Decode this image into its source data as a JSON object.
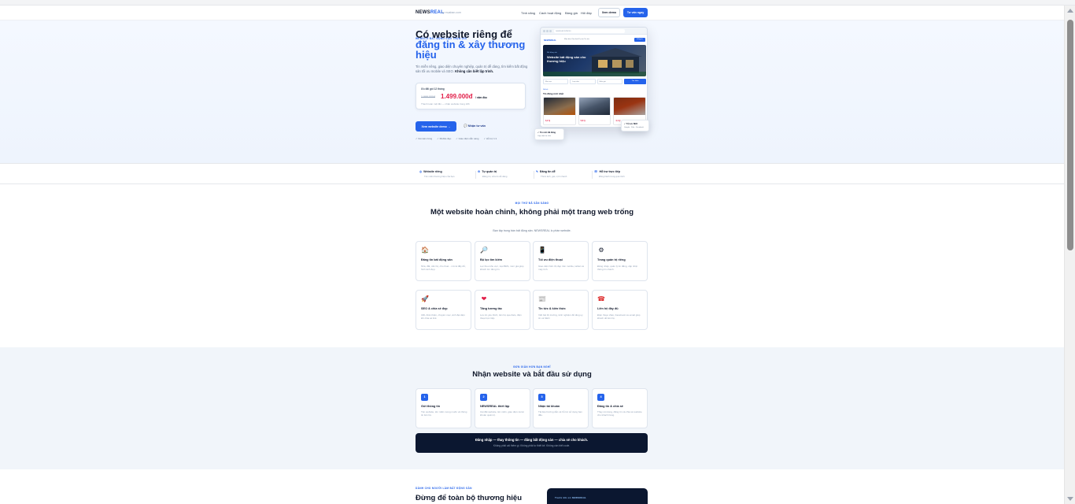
{
  "header": {
    "logo_main": "NEWS",
    "logo_accent": "REAL",
    "logo_sub": "by muaban.com",
    "nav": [
      "Tính năng",
      "Cách hoạt động",
      "Bảng giá",
      "Hỏi đáp"
    ],
    "demo_button": "Xem demo",
    "start_button": "Tư vấn ngay"
  },
  "hero": {
    "eyebrow": "Website bất động sản trọn gói",
    "title_line1": "Có website riêng để",
    "title_accent": "đăng tin & xây thương hiệu",
    "description": "Tin miễn riêng, giao diện chuyên nghiệp, quản trị dễ dàng, tìm kiếm bất động sản tối ưu mobile và SEO.",
    "description_bold": "Không cần biết lập trình.",
    "price_label": "Ưu đãi gói 12 tháng",
    "price_old": "1.999.000đ",
    "price_new": "1.499.000đ",
    "price_unit": "/ năm đầu",
    "price_note": "Thanh toán một lần — nhận website trong 24h",
    "cta_primary": "Xem website demo →",
    "cta_secondary": "Nhận tư vấn",
    "checks": [
      "Domain riêng",
      "Mobile đẹp",
      "Giao diện sẵn sàng",
      "Hỗ trợ 1:1"
    ]
  },
  "mockup": {
    "url": "newsreal.vn/demo",
    "logo": "NEWSREAL",
    "menu": "Mua bán   Cho thuê   Dự án   Tin tức",
    "button": "Đăng tin",
    "hero_tag": "Bất động sản",
    "hero_title": "Website bất động sản cho thương hiệu",
    "fields": [
      "Khu vực",
      "Loại nhà",
      "Mức giá"
    ],
    "search_button": "Tìm kiếm",
    "section_tag": "Nổi bật",
    "section_title": "Tin đăng mới nhất",
    "prices": [
      "3,2 tỷ",
      "5,8 tỷ",
      "4,1 tỷ"
    ],
    "float_a_title": "Tin mới đã đăng",
    "float_a_sub": "Cập nhật tức thời",
    "float_b_title": "Tối ưu SEO",
    "float_b_sub": "Google · Zalo · Facebook"
  },
  "strip": [
    {
      "title": "Website riêng",
      "sub": "Tên miền thương hiệu của bạn",
      "icon": "globe-icon"
    },
    {
      "title": "Tự quản trị",
      "sub": "Đăng tin, sửa tin dễ dàng",
      "icon": "gear-icon"
    },
    {
      "title": "Đăng tin dễ",
      "sub": "Thêm ảnh, giá, vị trí nhanh",
      "icon": "edit-icon"
    },
    {
      "title": "Hỗ trợ trực tiếp",
      "sub": "Đồng hành trong quá trình",
      "icon": "support-icon"
    }
  ],
  "features": {
    "eyebrow": "Mọi thứ đã sẵn sàng",
    "title": "Một website hoàn chỉnh, không phải một trang web trống",
    "subtitle": "Bạn tập trung bán bất động sản. NEWSREAL lo phần website.",
    "cards": [
      {
        "icon": "house-icon",
        "glyph": "🏠",
        "title": "Đăng tin bất động sản",
        "desc": "Nhà, đất, căn hộ, cho thuê... mô tả đầy đủ, hình ảnh đẹp."
      },
      {
        "icon": "search-icon",
        "glyph": "🔎",
        "title": "Bộ lọc tìm kiếm",
        "desc": "Lọc theo khu vực, loại BĐS, mức giá giúp khách tìm đúng tin."
      },
      {
        "icon": "phone-icon",
        "glyph": "📱",
        "title": "Tối ưu điện thoại",
        "desc": "Giao diện hiển thị đẹp trên mobile, tablet và máy tính."
      },
      {
        "icon": "dashboard-icon",
        "glyph": "⚙",
        "title": "Trang quản trị riêng",
        "desc": "Đăng nhập, quản lý tin đăng, cập nhật thông tin nhanh."
      },
      {
        "icon": "seo-icon",
        "glyph": "🚀",
        "title": "SEO & chia sẻ đẹp",
        "desc": "URL thân thiện, chuyên mục, ảnh đại diện khi chia sẻ link."
      },
      {
        "icon": "heart-icon",
        "glyph": "❤",
        "title": "Tăng tương tác",
        "desc": "Lưu tin yêu thích, liên hệ qua Zalo, điện thoại trực tiếp."
      },
      {
        "icon": "news-icon",
        "glyph": "📰",
        "title": "Tin tức & kiến thức",
        "desc": "Viết bài thị trường, kinh nghiệm để tăng uy tín và SEO."
      },
      {
        "icon": "contact-icon",
        "glyph": "☎",
        "title": "Liên hệ đầy đủ",
        "desc": "Điện thoại, Zalo, Facebook và email giúp khách dễ liên hệ."
      }
    ]
  },
  "steps": {
    "eyebrow": "Đơn giản hơn bạn nghĩ",
    "title": "Nhận website và bắt đầu sử dụng",
    "cards": [
      {
        "num": "1",
        "title": "Gửi thông tin",
        "desc": "Tên website, tên miền mong muốn và thông tin liên hệ."
      },
      {
        "num": "2",
        "title": "NEWSREAL thiết lập",
        "desc": "Cài đặt website, tên miền, giao diện và tài khoản quản trị."
      },
      {
        "num": "3",
        "title": "Nhận tài khoản",
        "desc": "Tài liệu hướng dẫn và hỗ trợ sử dụng ban đầu."
      },
      {
        "num": "4",
        "title": "Đăng tin & chia sẻ",
        "desc": "Thay nội dung, đăng tin và chia sẻ website cho khách hàng."
      }
    ],
    "banner_title": "Đăng nhập — thay thông tin — đăng bất động sản — chia sẻ cho khách.",
    "banner_sub": "Không phải cài thêm gì. Không phải tự thiết kế. Không cần biết code."
  },
  "bottom": {
    "eyebrow": "Dành cho người làm bất động sản",
    "title": "Đừng để toàn bộ thương hiệu chỉ",
    "card_tag": "Trước khi có NEWSREAL"
  },
  "colors": {
    "accent": "#2563eb",
    "price": "#e11d48",
    "dark": "#0b1730"
  }
}
